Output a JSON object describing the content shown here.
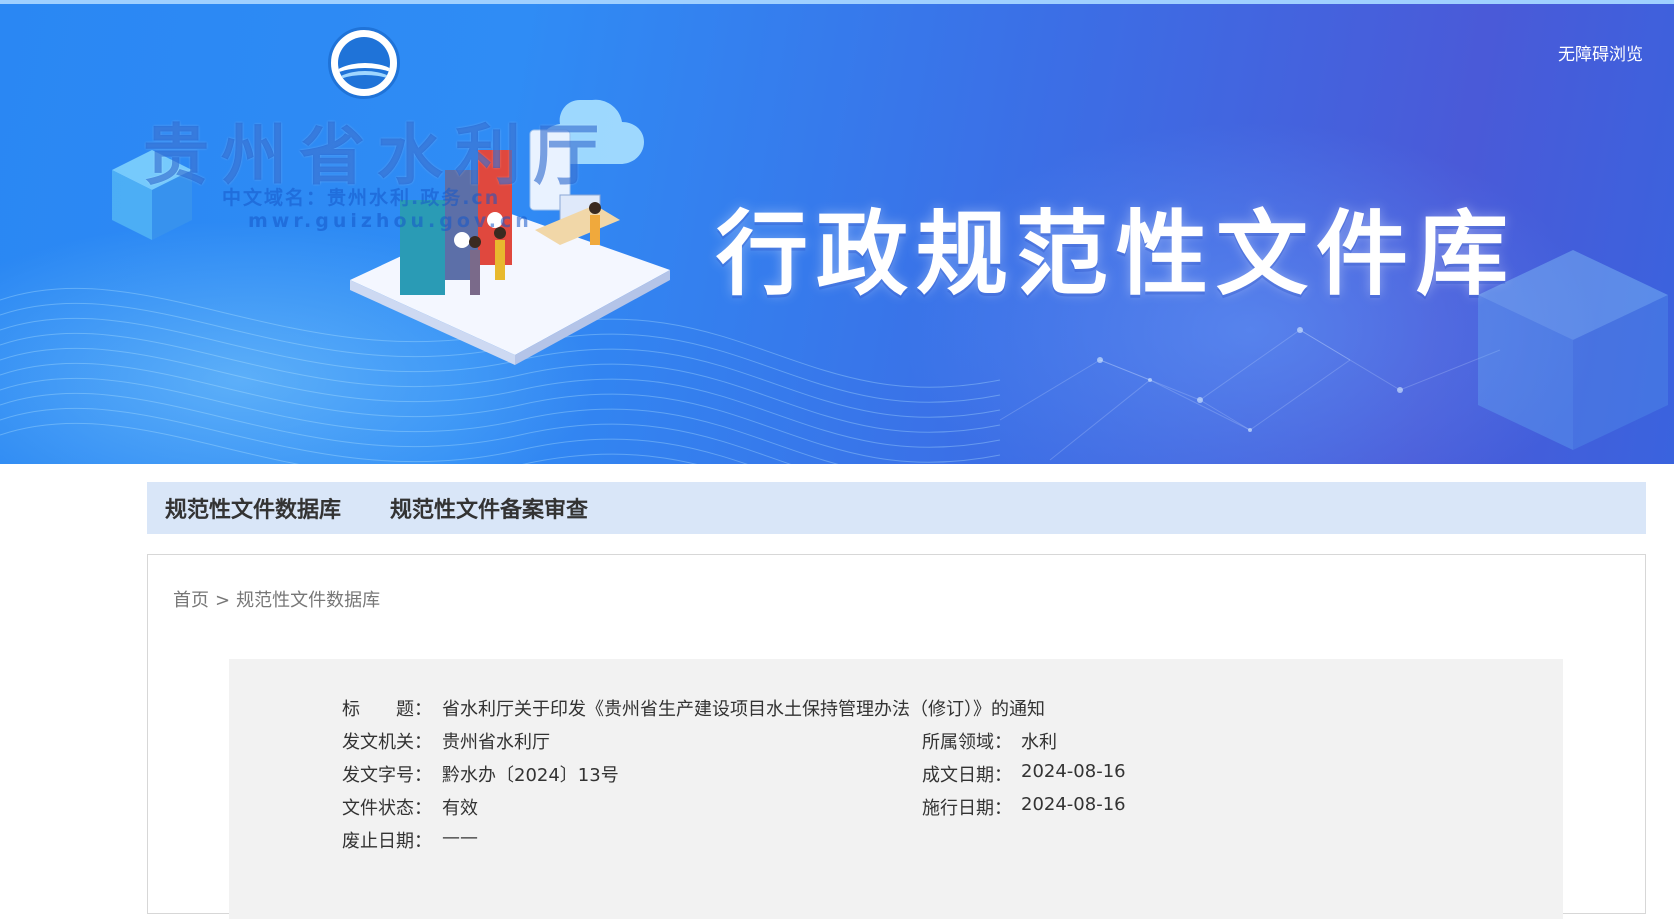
{
  "banner": {
    "org_name": "贵州省水利厅",
    "domain_cn": "中文域名：贵州水利.政务.cn",
    "domain_en": "mwr.guizhou.gov.cn",
    "title": "行政规范性文件库",
    "accessibility": "无障碍浏览"
  },
  "nav": {
    "items": [
      "规范性文件数据库",
      "规范性文件备案审查"
    ]
  },
  "breadcrumb": {
    "home": "首页",
    "separator": ">",
    "current": "规范性文件数据库"
  },
  "document": {
    "title_label": "标　　题：",
    "title_value": "省水利厅关于印发《贵州省生产建设项目水土保持管理办法（修订）》的通知",
    "issuer_label": "发文机关：",
    "issuer_value": "贵州省水利厅",
    "domain_label": "所属领域：",
    "domain_value": "水利",
    "number_label": "发文字号：",
    "number_value": "黔水办〔2024〕13号",
    "written_label": "成文日期：",
    "written_value": "2024-08-16",
    "status_label": "文件状态：",
    "status_value": "有效",
    "effective_label": "施行日期：",
    "effective_value": "2024-08-16",
    "repeal_label": "废止日期：",
    "repeal_value": "——"
  },
  "colors": {
    "banner_blue": "#2f8cf5",
    "banner_purple": "#4a5ad8",
    "nav_bg": "#d9e6f8",
    "panel_bg": "#f2f2f2"
  }
}
